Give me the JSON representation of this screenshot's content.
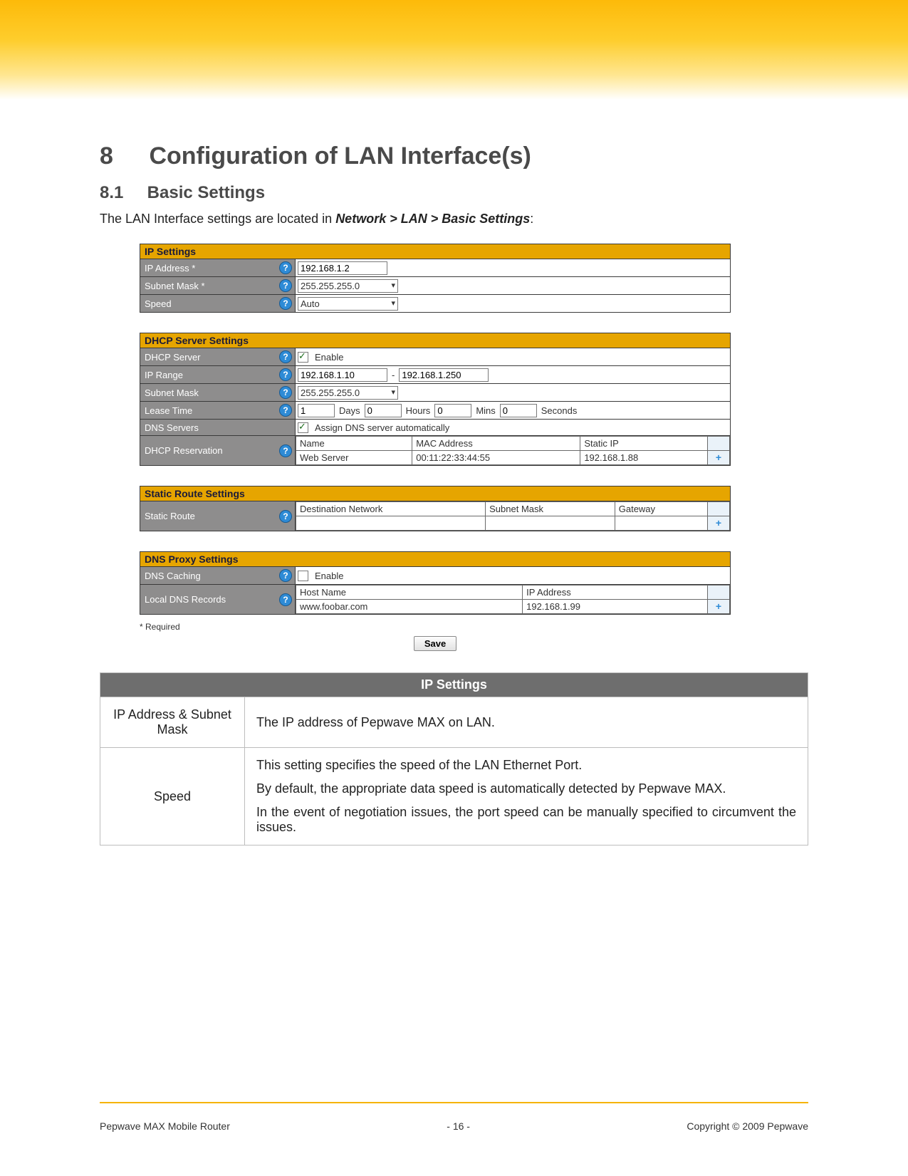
{
  "heading": {
    "num": "8",
    "title": "Configuration of LAN Interface(s)"
  },
  "sub": {
    "num": "8.1",
    "title": "Basic Settings"
  },
  "intro": {
    "pre": "The LAN Interface settings are located in ",
    "path": "Network > LAN > Basic Settings",
    "post": ":"
  },
  "panels": {
    "ip": {
      "title": "IP Settings",
      "rows": {
        "ip_address": {
          "label": "IP Address *",
          "value": "192.168.1.2"
        },
        "subnet": {
          "label": "Subnet Mask *",
          "value": "255.255.255.0"
        },
        "speed": {
          "label": "Speed",
          "value": "Auto"
        }
      }
    },
    "dhcp": {
      "title": "DHCP Server Settings",
      "rows": {
        "server": {
          "label": "DHCP Server",
          "enable_text": "Enable",
          "checked": true
        },
        "range": {
          "label": "IP Range",
          "from": "192.168.1.10",
          "sep": "-",
          "to": "192.168.1.250"
        },
        "subnet": {
          "label": "Subnet Mask",
          "value": "255.255.255.0"
        },
        "lease": {
          "label": "Lease Time",
          "days": "1",
          "days_lbl": "Days",
          "hours": "0",
          "hours_lbl": "Hours",
          "mins": "0",
          "mins_lbl": "Mins",
          "secs": "0",
          "secs_lbl": "Seconds"
        },
        "dns": {
          "label": "DNS Servers",
          "auto_text": "Assign DNS server automatically",
          "checked": true
        },
        "resv": {
          "label": "DHCP Reservation",
          "headers": {
            "name": "Name",
            "mac": "MAC Address",
            "ip": "Static IP"
          },
          "row": {
            "name": "Web Server",
            "mac": "00:11:22:33:44:55",
            "ip": "192.168.1.88"
          }
        }
      }
    },
    "static": {
      "title": "Static Route Settings",
      "rows": {
        "route": {
          "label": "Static Route",
          "headers": {
            "dest": "Destination Network",
            "mask": "Subnet Mask",
            "gw": "Gateway"
          }
        }
      }
    },
    "dns": {
      "title": "DNS Proxy Settings",
      "rows": {
        "caching": {
          "label": "DNS Caching",
          "enable_text": "Enable",
          "checked": false
        },
        "records": {
          "label": "Local DNS Records",
          "headers": {
            "host": "Host Name",
            "ip": "IP Address"
          },
          "row": {
            "host": "www.foobar.com",
            "ip": "192.168.1.99"
          }
        }
      }
    }
  },
  "required_note": "* Required",
  "save_label": "Save",
  "desc": {
    "header": "IP Settings",
    "r1": {
      "k": "IP Address & Subnet Mask",
      "v": "The IP address of Pepwave MAX on LAN."
    },
    "r2": {
      "k": "Speed",
      "p1": "This setting specifies the speed of the LAN Ethernet Port.",
      "p2": "By default, the appropriate data speed is automatically detected by Pepwave MAX.",
      "p3": "In the event of negotiation issues, the port speed can be manually specified to circumvent the issues."
    }
  },
  "footer": {
    "left": "Pepwave MAX Mobile Router",
    "center": "- 16 -",
    "right": "Copyright © 2009 Pepwave"
  }
}
